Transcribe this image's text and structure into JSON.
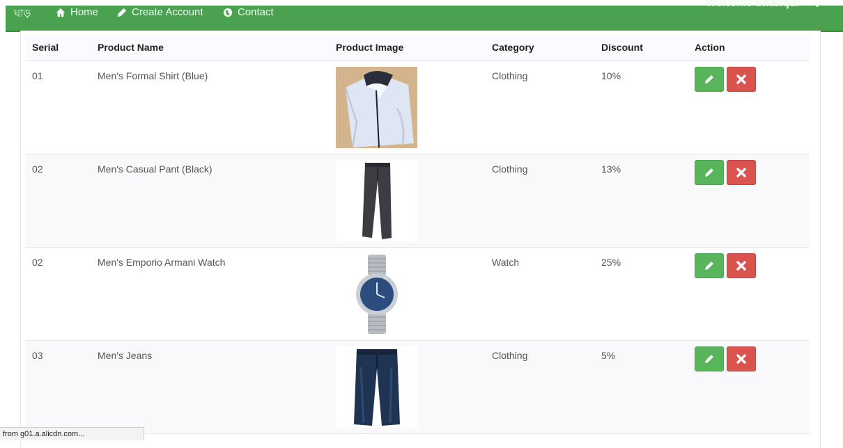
{
  "navbar": {
    "brand": "ঘাড়",
    "items": [
      {
        "label": "Home",
        "icon": "home-icon"
      },
      {
        "label": "Create Account",
        "icon": "pencil-icon"
      },
      {
        "label": "Contact",
        "icon": "globe-icon"
      }
    ],
    "welcome_prefix": "Welcome ",
    "welcome_user": "Shariqul"
  },
  "table": {
    "headers": [
      "Serial",
      "Product Name",
      "Product Image",
      "Category",
      "Discount",
      "Action"
    ],
    "rows": [
      {
        "serial": "01",
        "name": "Men's Formal Shirt (Blue)",
        "image": "shirt",
        "category": "Clothing",
        "discount": "10%"
      },
      {
        "serial": "02",
        "name": "Men's Casual Pant (Black)",
        "image": "pant",
        "category": "Clothing",
        "discount": "13%"
      },
      {
        "serial": "02",
        "name": "Men's Emporio Armani Watch",
        "image": "watch",
        "category": "Watch",
        "discount": "25%"
      },
      {
        "serial": "03",
        "name": "Men's Jeans",
        "image": "jeans",
        "category": "Clothing",
        "discount": "5%"
      }
    ]
  },
  "colors": {
    "navbar": "#4aa14f",
    "edit_button": "#58b55b",
    "delete_button": "#d9534f"
  },
  "status_bar": "from g01.a.alicdn.com..."
}
